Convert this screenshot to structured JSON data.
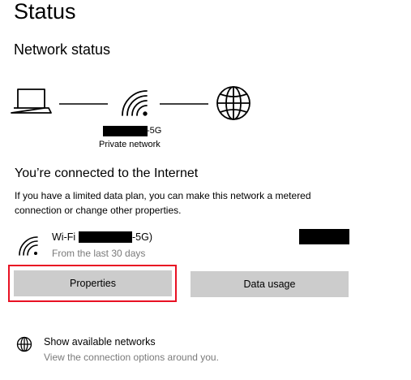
{
  "page": {
    "title": "Status"
  },
  "network_status": {
    "heading": "Network status",
    "ssid_visible_suffix": "-5G",
    "network_type": "Private network",
    "icons": [
      "laptop-icon",
      "wifi-icon",
      "globe-icon"
    ]
  },
  "connection": {
    "heading": "You’re connected to the Internet",
    "description": "If you have a limited data plan, you can make this network a metered connection or change other properties.",
    "wifi_label_prefix": "Wi-Fi",
    "wifi_label_suffix": "-5G)",
    "usage_note": "From the last 30 days"
  },
  "buttons": {
    "properties": "Properties",
    "data_usage": "Data usage"
  },
  "show_networks": {
    "title": "Show available networks",
    "subtitle": "View the connection options around you.",
    "icon": "globe-icon"
  },
  "colors": {
    "highlight_border": "#e81123",
    "button_bg": "#cccccc",
    "secondary_text": "#7a7a7a"
  }
}
